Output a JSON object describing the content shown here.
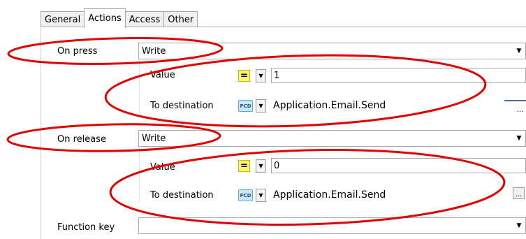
{
  "tabs": [
    {
      "label": "General",
      "active": false
    },
    {
      "label": "Actions",
      "active": true
    },
    {
      "label": "Access",
      "active": false
    },
    {
      "label": "Other",
      "active": false
    }
  ],
  "on_press": {
    "label": "On press",
    "action": "Write",
    "value_label": "Value",
    "operator": "=",
    "value": "1",
    "dest_label": "To destination",
    "dest_type": "PCD",
    "destination": "Application.Email.Send",
    "browse": "..."
  },
  "on_release": {
    "label": "On release",
    "action": "Write",
    "value_label": "Value",
    "operator": "=",
    "value": "0",
    "dest_label": "To destination",
    "dest_type": "PCD",
    "destination": "Application.Email.Send",
    "browse": "..."
  },
  "function_key": {
    "label": "Function key",
    "value": ""
  },
  "colors": {
    "annotation_red": "#e00000",
    "operator_yellow": "#fff46a",
    "pcd_blue": "#c9e7fb"
  }
}
